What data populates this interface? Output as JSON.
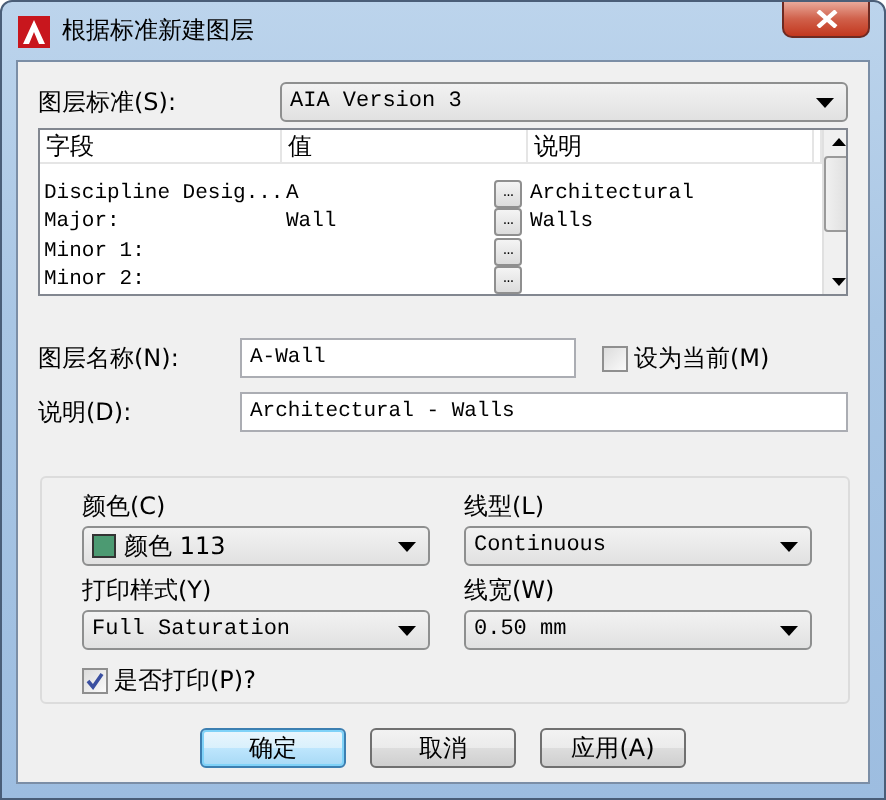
{
  "window": {
    "title": "根据标准新建图层"
  },
  "layer_standard": {
    "label": "图层标准(S):",
    "value": "AIA Version 3"
  },
  "table": {
    "columns": [
      "字段",
      "值",
      "说明"
    ],
    "rows": [
      {
        "field": "Discipline Desig...",
        "value": "A",
        "button": "...",
        "description": "Architectural"
      },
      {
        "field": "Major:",
        "value": "Wall",
        "button": "...",
        "description": "Walls"
      },
      {
        "field": "Minor 1:",
        "value": "",
        "button": "...",
        "description": ""
      },
      {
        "field": "Minor 2:",
        "value": "",
        "button": "...",
        "description": ""
      }
    ]
  },
  "layer_name": {
    "label": "图层名称(N):",
    "value": "A-Wall"
  },
  "set_current": {
    "label": "设为当前(M)",
    "checked": false
  },
  "description": {
    "label": "说明(D):",
    "value": "Architectural - Walls"
  },
  "properties": {
    "color": {
      "label": "颜色(C)",
      "value": "颜色 113",
      "color": "#4c9a72"
    },
    "linetype": {
      "label": "线型(L)",
      "value": "Continuous"
    },
    "plot_style": {
      "label": "打印样式(Y)",
      "value": "Full Saturation"
    },
    "lineweight": {
      "label": "线宽(W)",
      "value": "0.50 mm"
    },
    "plot": {
      "label": "是否打印(P)?",
      "checked": true
    }
  },
  "buttons": [
    {
      "label": "确定",
      "default": true
    },
    {
      "label": "取消",
      "default": false
    },
    {
      "label": "应用(A)",
      "default": false
    }
  ]
}
